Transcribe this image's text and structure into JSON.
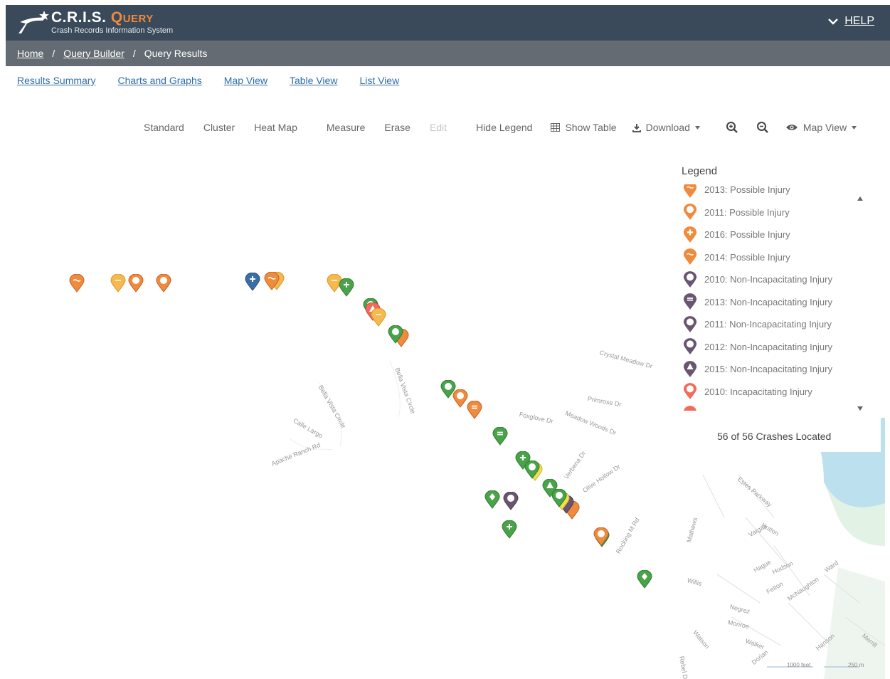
{
  "header": {
    "brand_main": "C.R.I.S.",
    "brand_query": "Query",
    "subtitle": "Crash Records Information System",
    "help_label": "HELP"
  },
  "breadcrumb": {
    "home": "Home",
    "query_builder": "Query Builder",
    "current": "Query Results",
    "separator": "/"
  },
  "tabs": [
    {
      "label": "Results Summary"
    },
    {
      "label": "Charts and Graphs"
    },
    {
      "label": "Map View"
    },
    {
      "label": "Table View"
    },
    {
      "label": "List View"
    }
  ],
  "toolbar": {
    "standard": "Standard",
    "cluster": "Cluster",
    "heat_map": "Heat Map",
    "measure": "Measure",
    "erase": "Erase",
    "edit": "Edit",
    "hide_legend": "Hide Legend",
    "show_table": "Show Table",
    "download": "Download",
    "map_view": "Map View"
  },
  "legend": {
    "title": "Legend",
    "items": [
      {
        "label": "2013: Possible Injury",
        "color": "#f08a3c",
        "glyph": "tilde"
      },
      {
        "label": "2011: Possible Injury",
        "color": "#f08a3c",
        "glyph": "ring"
      },
      {
        "label": "2016: Possible Injury",
        "color": "#f08a3c",
        "glyph": "plus"
      },
      {
        "label": "2014: Possible Injury",
        "color": "#f08a3c",
        "glyph": "tilde"
      },
      {
        "label": "2010: Non-Incapacitating Injury",
        "color": "#6a5570",
        "glyph": "ring"
      },
      {
        "label": "2013: Non-Incapacitating Injury",
        "color": "#6a5570",
        "glyph": "bars"
      },
      {
        "label": "2011: Non-Incapacitating Injury",
        "color": "#6a5570",
        "glyph": "ring"
      },
      {
        "label": "2012: Non-Incapacitating Injury",
        "color": "#6a5570",
        "glyph": "ring"
      },
      {
        "label": "2015: Non-Incapacitating Injury",
        "color": "#6a5570",
        "glyph": "triangle"
      },
      {
        "label": "2010: Incapacitating Injury",
        "color": "#f26a5a",
        "glyph": "ring"
      }
    ],
    "located_text": "56 of 56 Crashes Located"
  },
  "map": {
    "streets": [
      "Crystal Meadow Dr",
      "Primrose Dr",
      "Foxglove Dr",
      "Meadow Woods Dr",
      "Verbena Dr",
      "Olive Hollow Dr",
      "Bella Vista Circle",
      "Bella Vista Circle",
      "Calle Largo",
      "Apache Ranch Rd",
      "Rocking M Rd",
      "Estes Parkway",
      "Hutton",
      "Vargas",
      "Hague",
      "Hudson",
      "Ward",
      "Willis",
      "Felton",
      "McNaughton",
      "Rebel Dr",
      "Mathews",
      "Negrez",
      "Monroe",
      "Walker",
      "Hanson",
      "Merrill",
      "Watson",
      "Dorian"
    ],
    "scale_feet": "1000 feet",
    "scale_m": "250 m"
  },
  "colors": {
    "possible_injury": "#f08a3c",
    "possible_injury_light": "#f5b94e",
    "non_incapacitating": "#6a5570",
    "incapacitating": "#f26a5a",
    "green": "#4aa24a",
    "blue": "#3a6ea5",
    "yellow": "#f4e04d",
    "header": "#3a4a5a",
    "water": "#bde0ef"
  }
}
